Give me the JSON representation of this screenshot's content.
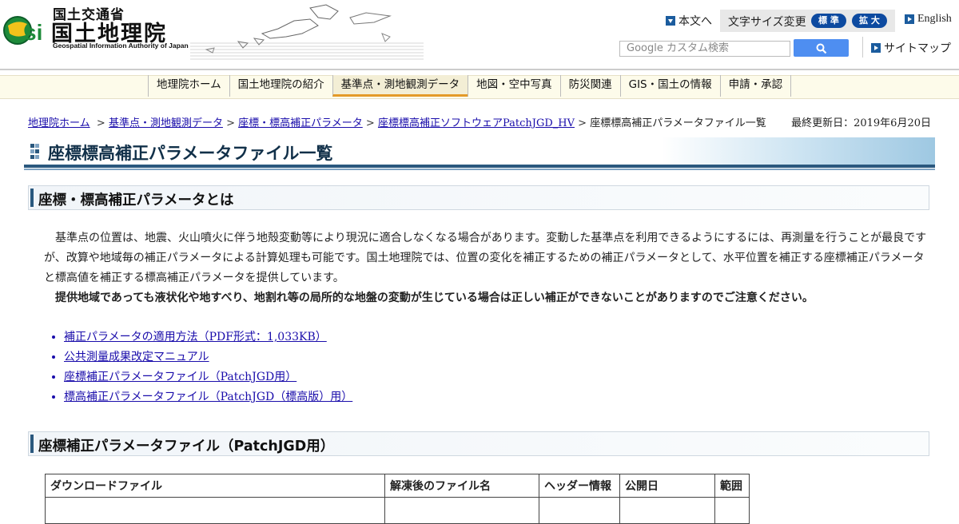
{
  "header": {
    "ministry": "国土交通省",
    "org_name": "国土地理院",
    "org_english": "Geospatial Information Authority of Japan",
    "skip_to_content": "本文へ",
    "font_size_label": "文字サイズ変更",
    "font_size_standard": "標 準",
    "font_size_large": "拡 大",
    "english_link": "English",
    "search_placeholder": "Google カスタム検索",
    "sitemap_link": "サイトマップ"
  },
  "nav": {
    "items": [
      {
        "label": "地理院ホーム"
      },
      {
        "label": "国土地理院の紹介"
      },
      {
        "label": "基準点・測地観測データ"
      },
      {
        "label": "地図・空中写真"
      },
      {
        "label": "防災関連"
      },
      {
        "label": "GIS・国土の情報"
      },
      {
        "label": "申請・承認"
      }
    ],
    "active_index": 2
  },
  "breadcrumb": {
    "items": [
      {
        "label": "地理院ホーム"
      },
      {
        "label": "基準点・測地観測データ"
      },
      {
        "label": "座標・標高補正パラメータ"
      },
      {
        "label": "座標標高補正ソフトウェアPatchJGD_HV"
      }
    ],
    "current": "座標標高補正パラメータファイル一覧",
    "updated": "最終更新日：2019年6月20日"
  },
  "page_title": "座標標高補正パラメータファイル一覧",
  "section1": {
    "heading": "座標・標高補正パラメータとは",
    "paragraph": "基準点の位置は、地震、火山噴火に伴う地殻変動等により現況に適合しなくなる場合があります。変動した基準点を利用できるようにするには、再測量を行うことが最良ですが、改算や地域毎の補正パラメータによる計算処理も可能です。国土地理院では、位置の変化を補正するための補正パラメータとして、水平位置を補正する座標補正パラメータと標高値を補正する標高補正パラメータを提供しています。",
    "warning": "提供地域であっても液状化や地すべり、地割れ等の局所的な地盤の変動が生じている場合は正しい補正ができないことがありますのでご注意ください。",
    "links": [
      "補正パラメータの適用方法（PDF形式：1,033KB）",
      "公共測量成果改定マニュアル",
      "座標補正パラメータファイル（PatchJGD用）",
      "標高補正パラメータファイル（PatchJGD（標高版）用）"
    ]
  },
  "section2": {
    "heading": "座標補正パラメータファイル（PatchJGD用）",
    "table_headers": [
      "ダウンロードファイル",
      "解凍後のファイル名",
      "ヘッダー情報",
      "公開日",
      "範囲"
    ]
  },
  "colors": {
    "nav_active_accent": "#e49a28",
    "title_underline": "#2a587e",
    "pill_blue": "#0d4aa0",
    "link": "#1a0dab"
  }
}
